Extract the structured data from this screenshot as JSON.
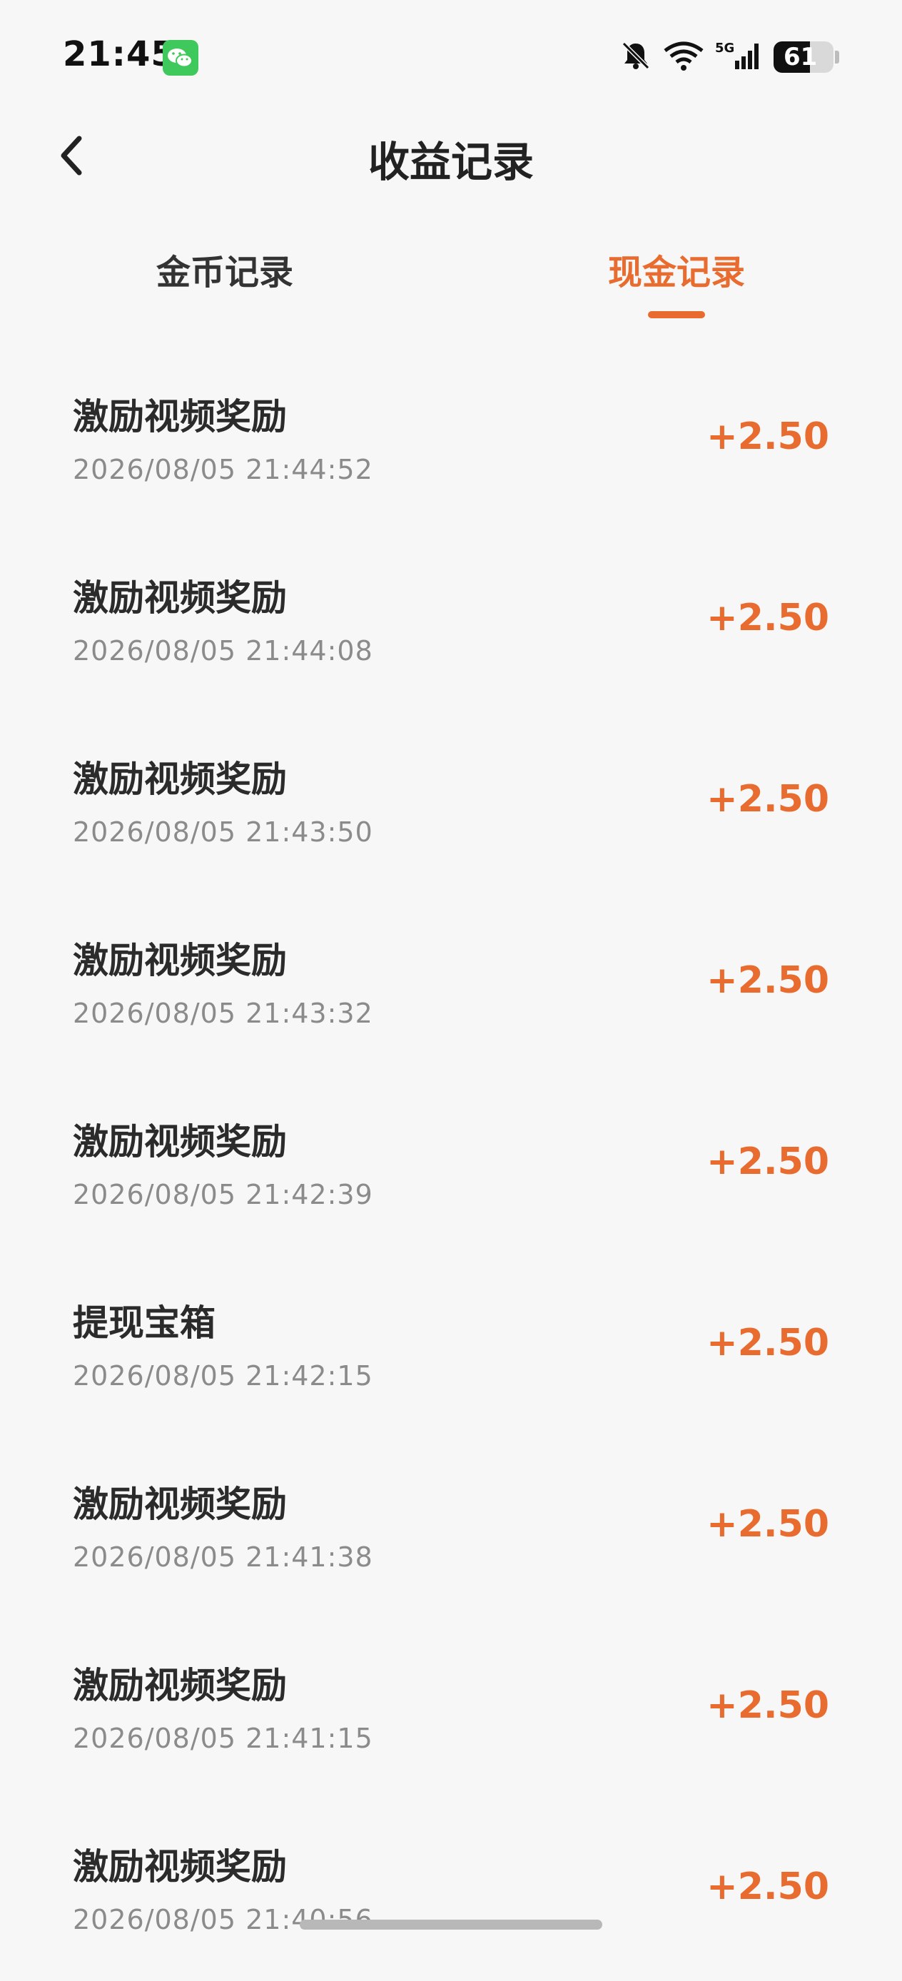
{
  "status_bar": {
    "time": "21:45",
    "battery": "61",
    "network": "5G"
  },
  "header": {
    "title": "收益记录"
  },
  "tabs": [
    {
      "label": "金币记录",
      "active": false
    },
    {
      "label": "现金记录",
      "active": true
    }
  ],
  "colors": {
    "accent": "#e86c2f",
    "background": "#f7f7f7",
    "text": "#2b2b2b",
    "muted": "#8b8b8b"
  },
  "records": [
    {
      "title": "激励视频奖励",
      "time": "2026/08/05 21:44:52",
      "amount": "+2.50"
    },
    {
      "title": "激励视频奖励",
      "time": "2026/08/05 21:44:08",
      "amount": "+2.50"
    },
    {
      "title": "激励视频奖励",
      "time": "2026/08/05 21:43:50",
      "amount": "+2.50"
    },
    {
      "title": "激励视频奖励",
      "time": "2026/08/05 21:43:32",
      "amount": "+2.50"
    },
    {
      "title": "激励视频奖励",
      "time": "2026/08/05 21:42:39",
      "amount": "+2.50"
    },
    {
      "title": "提现宝箱",
      "time": "2026/08/05 21:42:15",
      "amount": "+2.50"
    },
    {
      "title": "激励视频奖励",
      "time": "2026/08/05 21:41:38",
      "amount": "+2.50"
    },
    {
      "title": "激励视频奖励",
      "time": "2026/08/05 21:41:15",
      "amount": "+2.50"
    },
    {
      "title": "激励视频奖励",
      "time": "2026/08/05 21:40:56",
      "amount": "+2.50"
    }
  ]
}
